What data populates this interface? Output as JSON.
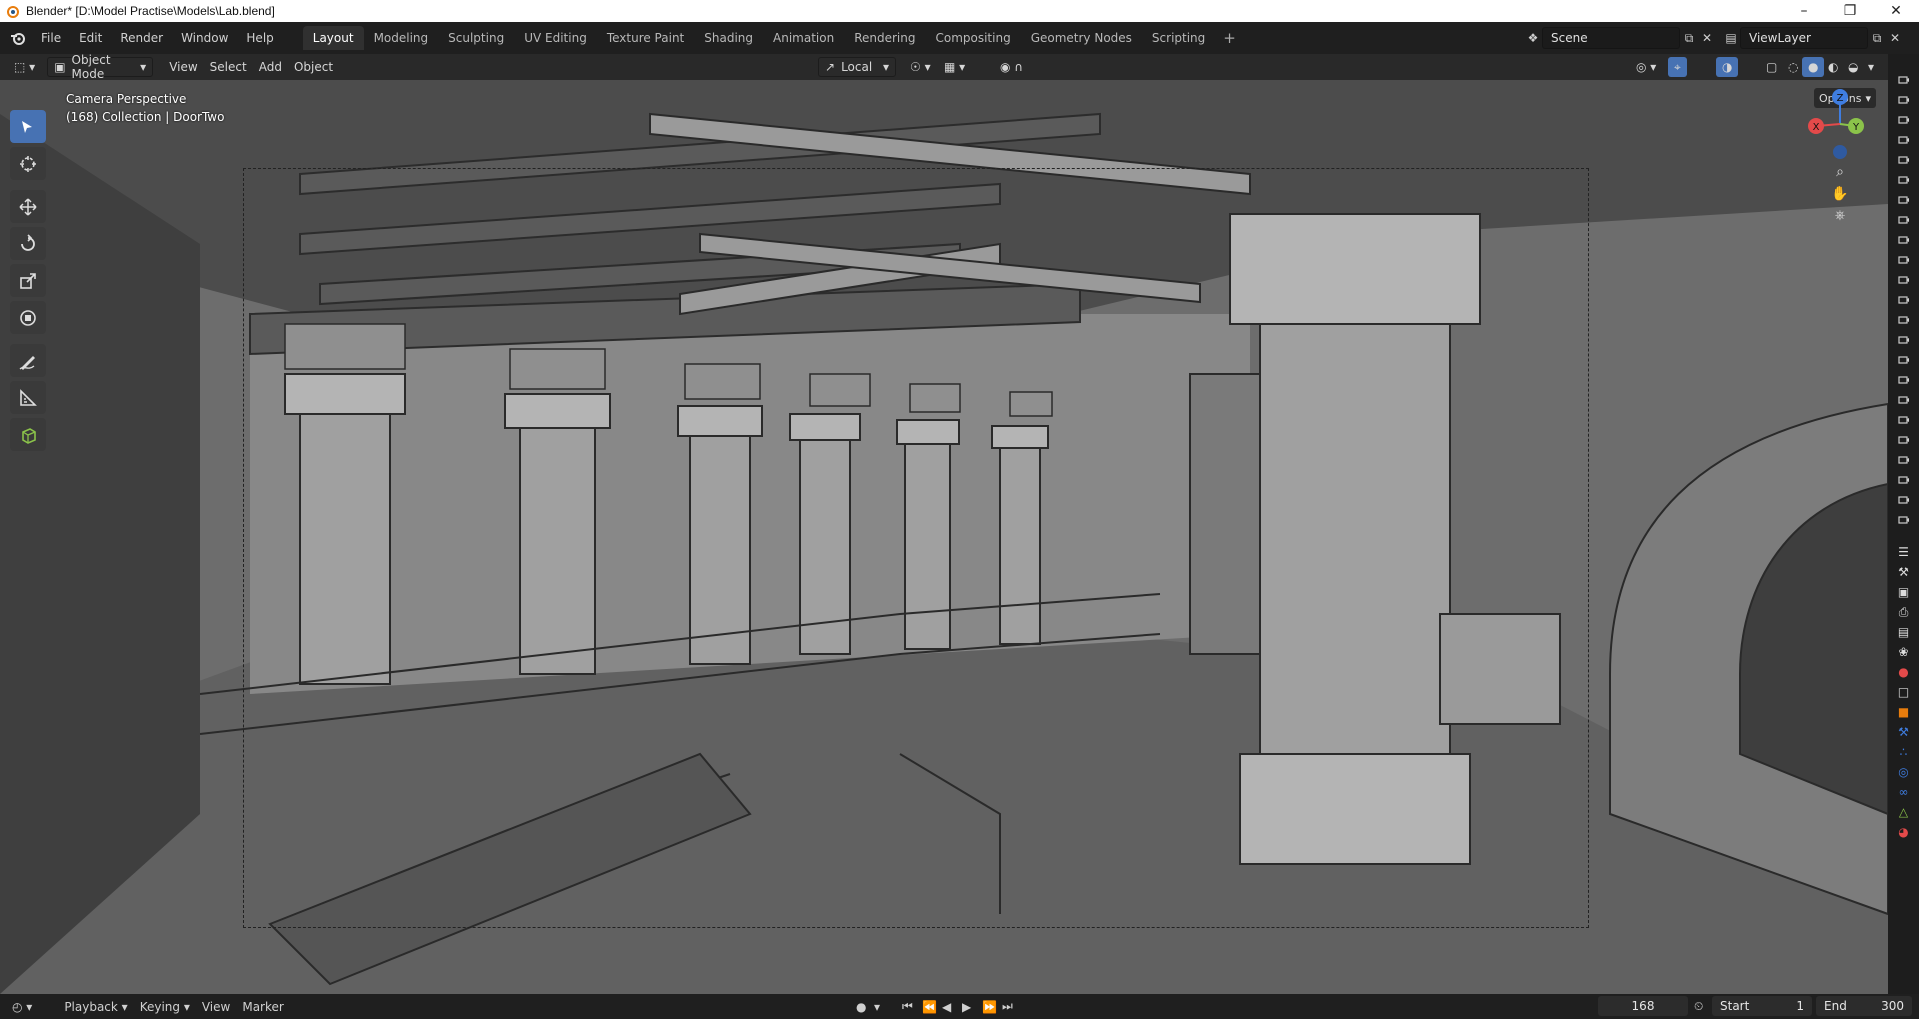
{
  "window": {
    "title": "Blender* [D:\\Model Practise\\Models\\Lab.blend]",
    "controls": [
      "minimize-icon",
      "restore-icon",
      "close-icon"
    ]
  },
  "menu": [
    "File",
    "Edit",
    "Render",
    "Window",
    "Help"
  ],
  "workspaces": [
    {
      "label": "Layout",
      "active": true
    },
    {
      "label": "Modeling"
    },
    {
      "label": "Sculpting"
    },
    {
      "label": "UV Editing"
    },
    {
      "label": "Texture Paint"
    },
    {
      "label": "Shading"
    },
    {
      "label": "Animation"
    },
    {
      "label": "Rendering"
    },
    {
      "label": "Compositing"
    },
    {
      "label": "Geometry Nodes"
    },
    {
      "label": "Scripting"
    }
  ],
  "scene": {
    "name": "Scene"
  },
  "view_layer": {
    "name": "ViewLayer"
  },
  "viewport_header": {
    "mode": "Object Mode",
    "menus": [
      "View",
      "Select",
      "Add",
      "Object"
    ],
    "transform_orientation": "Local",
    "options_label": "Options"
  },
  "viewport": {
    "camera_label": "Camera Perspective",
    "collection_label": "(168) Collection | DoorTwo",
    "gizmo_axes": {
      "x": "X",
      "y": "Y",
      "z": "Z"
    }
  },
  "toolbar_tools": [
    "select-box-icon",
    "cursor-icon",
    "move-icon",
    "rotate-icon",
    "scale-icon",
    "transform-icon",
    "annotate-icon",
    "measure-icon",
    "add-cube-icon"
  ],
  "timeline": {
    "menus": [
      "Playback",
      "Keying",
      "View",
      "Marker"
    ],
    "current_frame": "168",
    "start_label": "Start",
    "start_value": "1",
    "end_label": "End",
    "end_value": "300"
  },
  "colors": {
    "accent": "#4772b3",
    "axis_x": "#e34a4a",
    "axis_y": "#8bc34a",
    "axis_z": "#3f7de0"
  }
}
